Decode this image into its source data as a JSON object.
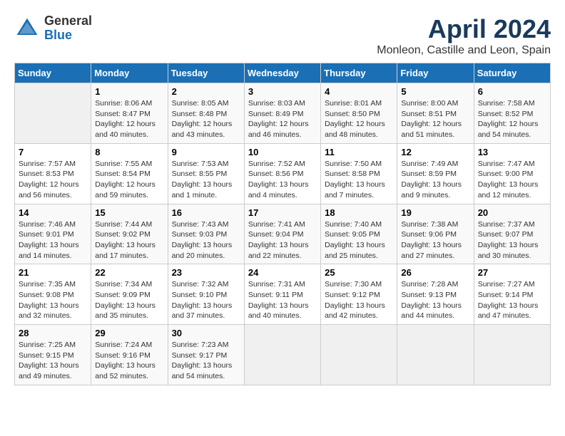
{
  "logo": {
    "general": "General",
    "blue": "Blue"
  },
  "title": "April 2024",
  "subtitle": "Monleon, Castille and Leon, Spain",
  "days": [
    "Sunday",
    "Monday",
    "Tuesday",
    "Wednesday",
    "Thursday",
    "Friday",
    "Saturday"
  ],
  "weeks": [
    [
      {
        "day": "",
        "empty": true
      },
      {
        "day": "1",
        "sunrise": "Sunrise: 8:06 AM",
        "sunset": "Sunset: 8:47 PM",
        "daylight": "Daylight: 12 hours and 40 minutes."
      },
      {
        "day": "2",
        "sunrise": "Sunrise: 8:05 AM",
        "sunset": "Sunset: 8:48 PM",
        "daylight": "Daylight: 12 hours and 43 minutes."
      },
      {
        "day": "3",
        "sunrise": "Sunrise: 8:03 AM",
        "sunset": "Sunset: 8:49 PM",
        "daylight": "Daylight: 12 hours and 46 minutes."
      },
      {
        "day": "4",
        "sunrise": "Sunrise: 8:01 AM",
        "sunset": "Sunset: 8:50 PM",
        "daylight": "Daylight: 12 hours and 48 minutes."
      },
      {
        "day": "5",
        "sunrise": "Sunrise: 8:00 AM",
        "sunset": "Sunset: 8:51 PM",
        "daylight": "Daylight: 12 hours and 51 minutes."
      },
      {
        "day": "6",
        "sunrise": "Sunrise: 7:58 AM",
        "sunset": "Sunset: 8:52 PM",
        "daylight": "Daylight: 12 hours and 54 minutes."
      }
    ],
    [
      {
        "day": "7",
        "sunrise": "Sunrise: 7:57 AM",
        "sunset": "Sunset: 8:53 PM",
        "daylight": "Daylight: 12 hours and 56 minutes."
      },
      {
        "day": "8",
        "sunrise": "Sunrise: 7:55 AM",
        "sunset": "Sunset: 8:54 PM",
        "daylight": "Daylight: 12 hours and 59 minutes."
      },
      {
        "day": "9",
        "sunrise": "Sunrise: 7:53 AM",
        "sunset": "Sunset: 8:55 PM",
        "daylight": "Daylight: 13 hours and 1 minute."
      },
      {
        "day": "10",
        "sunrise": "Sunrise: 7:52 AM",
        "sunset": "Sunset: 8:56 PM",
        "daylight": "Daylight: 13 hours and 4 minutes."
      },
      {
        "day": "11",
        "sunrise": "Sunrise: 7:50 AM",
        "sunset": "Sunset: 8:58 PM",
        "daylight": "Daylight: 13 hours and 7 minutes."
      },
      {
        "day": "12",
        "sunrise": "Sunrise: 7:49 AM",
        "sunset": "Sunset: 8:59 PM",
        "daylight": "Daylight: 13 hours and 9 minutes."
      },
      {
        "day": "13",
        "sunrise": "Sunrise: 7:47 AM",
        "sunset": "Sunset: 9:00 PM",
        "daylight": "Daylight: 13 hours and 12 minutes."
      }
    ],
    [
      {
        "day": "14",
        "sunrise": "Sunrise: 7:46 AM",
        "sunset": "Sunset: 9:01 PM",
        "daylight": "Daylight: 13 hours and 14 minutes."
      },
      {
        "day": "15",
        "sunrise": "Sunrise: 7:44 AM",
        "sunset": "Sunset: 9:02 PM",
        "daylight": "Daylight: 13 hours and 17 minutes."
      },
      {
        "day": "16",
        "sunrise": "Sunrise: 7:43 AM",
        "sunset": "Sunset: 9:03 PM",
        "daylight": "Daylight: 13 hours and 20 minutes."
      },
      {
        "day": "17",
        "sunrise": "Sunrise: 7:41 AM",
        "sunset": "Sunset: 9:04 PM",
        "daylight": "Daylight: 13 hours and 22 minutes."
      },
      {
        "day": "18",
        "sunrise": "Sunrise: 7:40 AM",
        "sunset": "Sunset: 9:05 PM",
        "daylight": "Daylight: 13 hours and 25 minutes."
      },
      {
        "day": "19",
        "sunrise": "Sunrise: 7:38 AM",
        "sunset": "Sunset: 9:06 PM",
        "daylight": "Daylight: 13 hours and 27 minutes."
      },
      {
        "day": "20",
        "sunrise": "Sunrise: 7:37 AM",
        "sunset": "Sunset: 9:07 PM",
        "daylight": "Daylight: 13 hours and 30 minutes."
      }
    ],
    [
      {
        "day": "21",
        "sunrise": "Sunrise: 7:35 AM",
        "sunset": "Sunset: 9:08 PM",
        "daylight": "Daylight: 13 hours and 32 minutes."
      },
      {
        "day": "22",
        "sunrise": "Sunrise: 7:34 AM",
        "sunset": "Sunset: 9:09 PM",
        "daylight": "Daylight: 13 hours and 35 minutes."
      },
      {
        "day": "23",
        "sunrise": "Sunrise: 7:32 AM",
        "sunset": "Sunset: 9:10 PM",
        "daylight": "Daylight: 13 hours and 37 minutes."
      },
      {
        "day": "24",
        "sunrise": "Sunrise: 7:31 AM",
        "sunset": "Sunset: 9:11 PM",
        "daylight": "Daylight: 13 hours and 40 minutes."
      },
      {
        "day": "25",
        "sunrise": "Sunrise: 7:30 AM",
        "sunset": "Sunset: 9:12 PM",
        "daylight": "Daylight: 13 hours and 42 minutes."
      },
      {
        "day": "26",
        "sunrise": "Sunrise: 7:28 AM",
        "sunset": "Sunset: 9:13 PM",
        "daylight": "Daylight: 13 hours and 44 minutes."
      },
      {
        "day": "27",
        "sunrise": "Sunrise: 7:27 AM",
        "sunset": "Sunset: 9:14 PM",
        "daylight": "Daylight: 13 hours and 47 minutes."
      }
    ],
    [
      {
        "day": "28",
        "sunrise": "Sunrise: 7:25 AM",
        "sunset": "Sunset: 9:15 PM",
        "daylight": "Daylight: 13 hours and 49 minutes."
      },
      {
        "day": "29",
        "sunrise": "Sunrise: 7:24 AM",
        "sunset": "Sunset: 9:16 PM",
        "daylight": "Daylight: 13 hours and 52 minutes."
      },
      {
        "day": "30",
        "sunrise": "Sunrise: 7:23 AM",
        "sunset": "Sunset: 9:17 PM",
        "daylight": "Daylight: 13 hours and 54 minutes."
      },
      {
        "day": "",
        "empty": true
      },
      {
        "day": "",
        "empty": true
      },
      {
        "day": "",
        "empty": true
      },
      {
        "day": "",
        "empty": true
      }
    ]
  ]
}
